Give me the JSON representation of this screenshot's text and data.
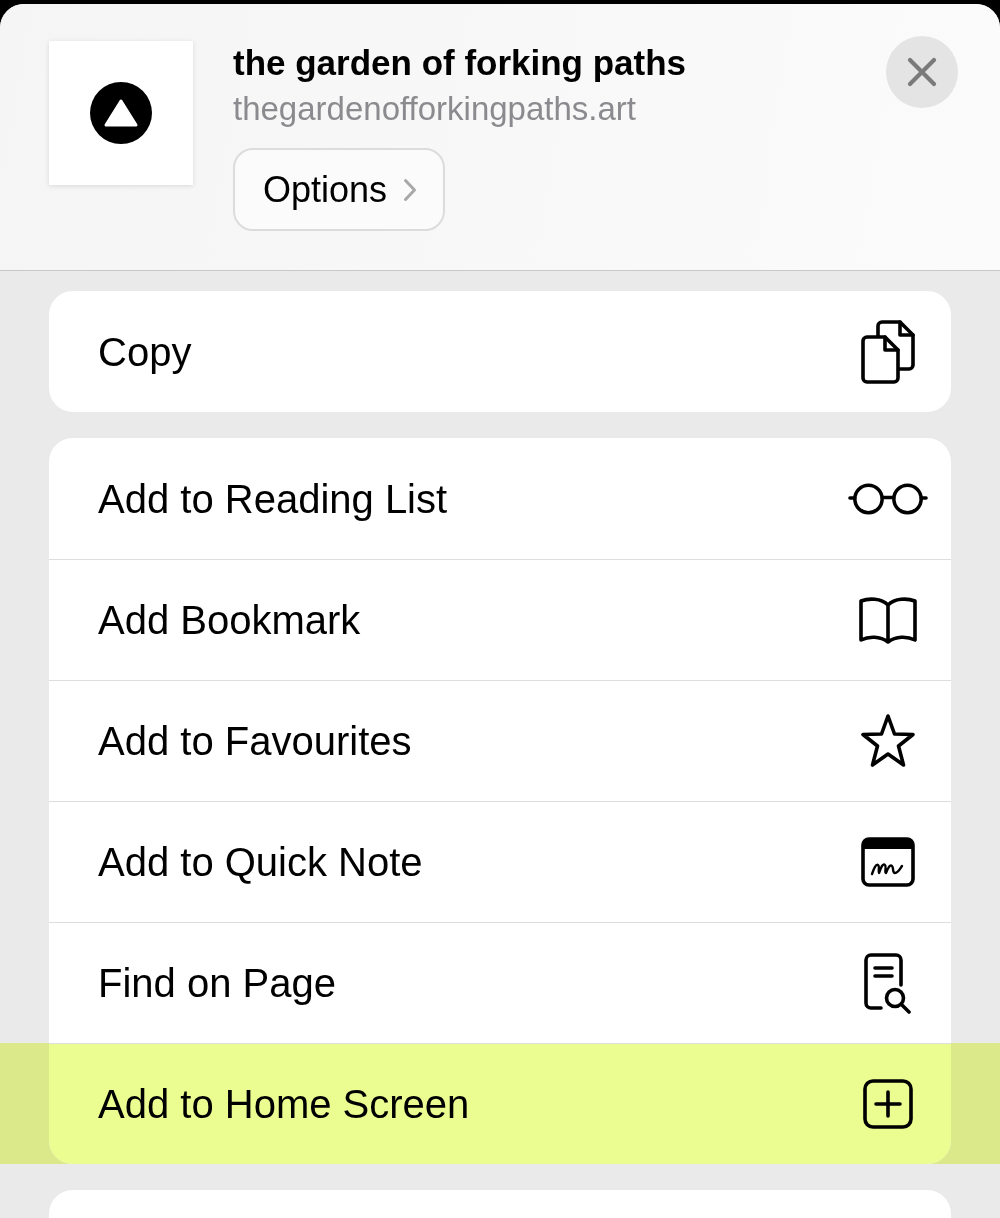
{
  "header": {
    "title": "the garden of forking paths",
    "url": "thegardenofforkingpaths.art",
    "options_button": "Options"
  },
  "action_groups": [
    {
      "items": [
        {
          "label": "Copy",
          "kind": "copy",
          "highlighted": false
        }
      ]
    },
    {
      "items": [
        {
          "label": "Add to Reading List",
          "kind": "readinglist",
          "highlighted": false
        },
        {
          "label": "Add Bookmark",
          "kind": "bookmark",
          "highlighted": false
        },
        {
          "label": "Add to Favourites",
          "kind": "favourite",
          "highlighted": false
        },
        {
          "label": "Add to Quick Note",
          "kind": "quicknote",
          "highlighted": false
        },
        {
          "label": "Find on Page",
          "kind": "find",
          "highlighted": false
        },
        {
          "label": "Add to Home Screen",
          "kind": "homescreen",
          "highlighted": true
        }
      ]
    }
  ]
}
